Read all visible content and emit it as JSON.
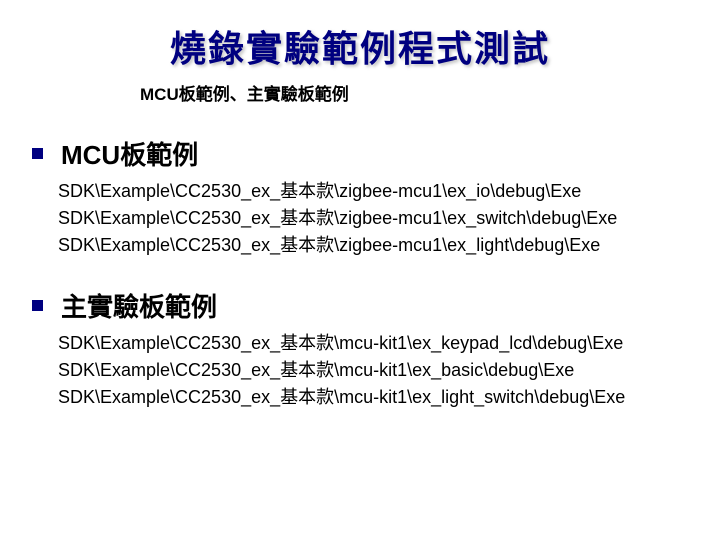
{
  "title": "燒錄實驗範例程式測試",
  "subtitle": "MCU板範例、主實驗板範例",
  "sections": [
    {
      "heading": "MCU板範例",
      "paths": [
        "SDK\\Example\\CC2530_ex_基本款\\zigbee-mcu1\\ex_io\\debug\\Exe",
        "SDK\\Example\\CC2530_ex_基本款\\zigbee-mcu1\\ex_switch\\debug\\Exe",
        "SDK\\Example\\CC2530_ex_基本款\\zigbee-mcu1\\ex_light\\debug\\Exe"
      ]
    },
    {
      "heading": "主實驗板範例",
      "paths": [
        "SDK\\Example\\CC2530_ex_基本款\\mcu-kit1\\ex_keypad_lcd\\debug\\Exe",
        "SDK\\Example\\CC2530_ex_基本款\\mcu-kit1\\ex_basic\\debug\\Exe",
        "SDK\\Example\\CC2530_ex_基本款\\mcu-kit1\\ex_light_switch\\debug\\Exe"
      ]
    }
  ]
}
